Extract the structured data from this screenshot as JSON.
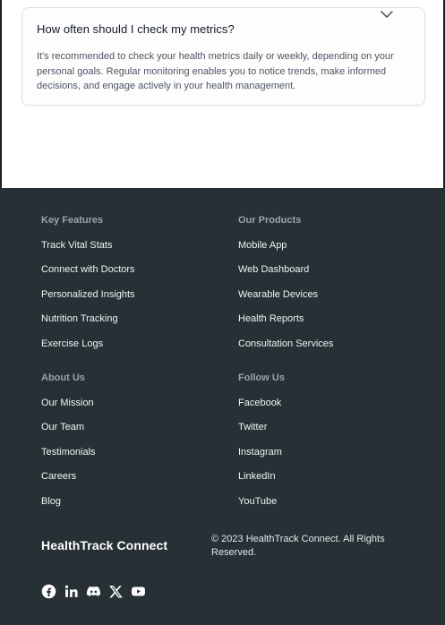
{
  "faq": {
    "question": "How often should I check my metrics?",
    "answer": "It's recommended to check your health metrics daily or weekly, depending on your personal goals. Regular monitoring enables you to notice trends, make informed decisions, and engage actively in your health management."
  },
  "footer": {
    "key_features": {
      "heading": "Key Features",
      "links": [
        "Track Vital Stats",
        "Connect with Doctors",
        "Personalized Insights",
        "Nutrition Tracking",
        "Exercise Logs"
      ]
    },
    "our_products": {
      "heading": "Our Products",
      "links": [
        "Mobile App",
        "Web Dashboard",
        "Wearable Devices",
        "Health Reports",
        "Consultation Services"
      ]
    },
    "about_us": {
      "heading": "About Us",
      "links": [
        "Our Mission",
        "Our Team",
        "Testimonials",
        "Careers",
        "Blog"
      ]
    },
    "follow_us": {
      "heading": "Follow Us",
      "links": [
        "Facebook",
        "Twitter",
        "Instagram",
        "LinkedIn",
        "YouTube"
      ]
    },
    "brand": "HealthTrack Connect",
    "copyright": "© 2023 HealthTrack Connect. All Rights Reserved.",
    "social_icons": [
      "facebook-icon",
      "linkedin-icon",
      "discord-icon",
      "x-icon",
      "youtube-icon"
    ],
    "colors": {
      "background": "#263035",
      "heading": "#9aa3ad",
      "link": "#f1f3f5"
    }
  }
}
